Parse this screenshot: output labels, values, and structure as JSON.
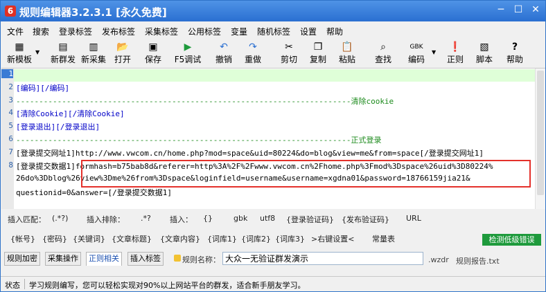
{
  "window": {
    "title": "规则编辑器3.2.3.1 [永久免费]",
    "app_icon_glyph": "6"
  },
  "menu": [
    "文件",
    "搜索",
    "登录标签",
    "发布标签",
    "采集标签",
    "公用标签",
    "变量",
    "随机标签",
    "设置",
    "帮助"
  ],
  "toolbar": [
    {
      "icon": "new-template-icon",
      "glyph": "▦",
      "label": "新模板"
    },
    {
      "icon": "new-publish-icon",
      "glyph": "▤",
      "label": "新群发"
    },
    {
      "icon": "new-collect-icon",
      "glyph": "▥",
      "label": "新采集"
    },
    {
      "icon": "open-folder-icon",
      "glyph": "📂",
      "label": "打开"
    },
    {
      "icon": "save-icon",
      "glyph": "▣",
      "label": "保存"
    },
    {
      "icon": "debug-run-icon",
      "glyph": "▶",
      "label": "F5调试"
    },
    {
      "icon": "undo-icon",
      "glyph": "↶",
      "label": "撤销"
    },
    {
      "icon": "redo-icon",
      "glyph": "↷",
      "label": "重做"
    },
    {
      "icon": "scissors-icon",
      "glyph": "✂",
      "label": "剪切"
    },
    {
      "icon": "copy-icon",
      "glyph": "❐",
      "label": "复制"
    },
    {
      "icon": "paste-icon",
      "glyph": "📋",
      "label": "粘贴"
    },
    {
      "icon": "binoculars-icon",
      "glyph": "⌕",
      "label": "查找"
    },
    {
      "icon": "encoding-icon",
      "glyph": "GBK",
      "label": "编码"
    },
    {
      "icon": "warning-icon",
      "glyph": "❗",
      "label": "正则"
    },
    {
      "icon": "script-icon",
      "glyph": "▧",
      "label": "脚本"
    },
    {
      "icon": "help-icon",
      "glyph": "?",
      "label": "帮助"
    }
  ],
  "editor": {
    "lines": [
      {
        "n": "1",
        "text": ""
      },
      {
        "n": "2",
        "text": "[编码][/编码]"
      },
      {
        "n": "3",
        "text": "-------------------------------------------------------------------------清除cookie"
      },
      {
        "n": "4",
        "text": "[清除Cookie][/清除Cookie]"
      },
      {
        "n": "5",
        "text": "[登录退出][/登录退出]"
      },
      {
        "n": "6",
        "text": "-------------------------------------------------------------------------正式登录"
      },
      {
        "n": "7",
        "text": "[登录提交网址1]http://www.vwcom.cn/home.php?mod=space&uid=80224&do=blog&view=me&from=space[/登录提交网址1]"
      },
      {
        "n": "8",
        "text": "[登录提交数据1]formhash=b75bab8d&referer=http%3A%2F%2Fwww.vwcom.cn%2Fhome.php%3Fmod%3Dspace%26uid%3D80224%"
      },
      {
        "n": "",
        "text": "26do%3Dblog%26view%3Dme%26from%3Dspace&loginfield=username&username=xgdna01&password=18766159jia21&"
      },
      {
        "n": "",
        "text": "questionid=0&answer=[/登录提交数据1]"
      }
    ]
  },
  "hints_row1": [
    "插入匹配：",
    "(.*?)",
    "插入排除：",
    ".*?",
    "插入：",
    "{}",
    "gbk",
    "utf8",
    "{登录验证码}",
    "{发布验证码}",
    "URL"
  ],
  "hints_row2": [
    "{帐号}",
    "{密码}",
    "{关键词}",
    "{文章标题}",
    "{文章内容}",
    "{词库1}",
    "{词库2}",
    "{词库3}",
    ">右键设置<",
    "常量表"
  ],
  "check_button": "检测低级错误",
  "tabs": [
    "规则加密",
    "采集操作",
    "正则相关",
    "插入标签"
  ],
  "active_tab": "正则相关",
  "rule_name": {
    "label": "规则名称：",
    "value": "大众一无验证群发演示",
    "ext": ".wzdr",
    "report": "规则报告.txt"
  },
  "status": {
    "label": "状态",
    "text": "学习规则编写，您可以轻松实现对90%以上网站平台的群发，适合新手朋友学习。"
  },
  "colors": {
    "title_bar": "#2a6fd1",
    "tag_text": "#0000c8",
    "comment_text": "#1b8a1b",
    "highlight_box": "#e4302a",
    "check_button": "#1e9a3c"
  }
}
